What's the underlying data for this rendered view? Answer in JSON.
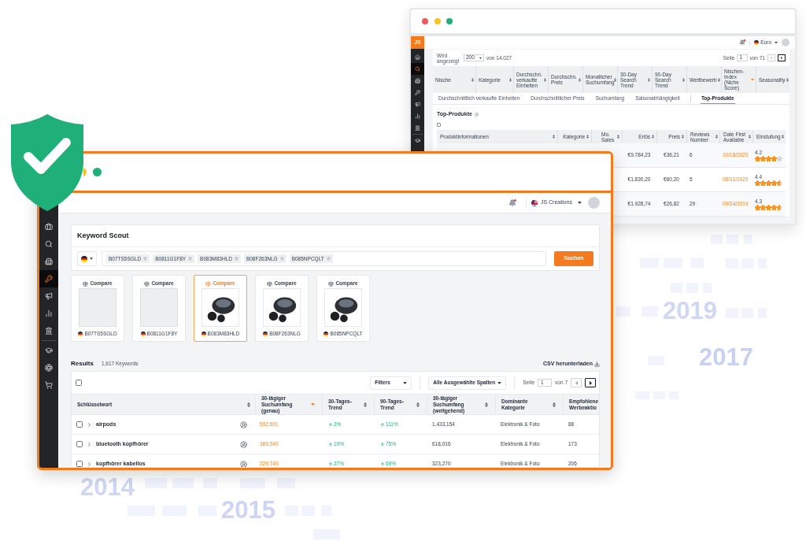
{
  "background": {
    "years": [
      "2019",
      "2017",
      "2014",
      "2015"
    ]
  },
  "back_window": {
    "logo": "JS",
    "sidebar_groups": [
      [
        {
          "selected": false
        },
        {
          "selected": true
        },
        {
          "selected": false
        },
        {
          "selected": false
        },
        {
          "selected": false
        },
        {
          "selected": false
        },
        {
          "selected": false
        }
      ],
      [
        {
          "selected": false
        }
      ]
    ],
    "currency": "Euro",
    "pager": {
      "shown_label": "Wird angezeigt",
      "page_size": "200",
      "total": "von 14.027",
      "page_label": "Seite",
      "page": "1",
      "page_count": "von 71"
    },
    "niche_columns": [
      {
        "label": "Nische",
        "sorted": false
      },
      {
        "label": "Kategorie",
        "sorted": false
      },
      {
        "label": "Durchschn. verkaufte Einheiten",
        "sorted": false
      },
      {
        "label": "Durchschn. Preis",
        "sorted": false
      },
      {
        "label": "Monatlicher Suchumfang",
        "sorted": false
      },
      {
        "label": "30-Day Search Trend",
        "sorted": false
      },
      {
        "label": "90-Day Search Trend",
        "sorted": false
      },
      {
        "label": "Wettbewerb",
        "sorted": false
      },
      {
        "label": "Nischen-Index (Niche Score)",
        "sorted": true
      },
      {
        "label": "Seasonality",
        "sorted": false
      }
    ],
    "tabs": [
      {
        "label": "Durchschnittlich verkaufte Einheiten",
        "selected": false
      },
      {
        "label": "Durchschnittlicher Preis",
        "selected": false
      },
      {
        "label": "Suchumfang",
        "selected": false
      },
      {
        "label": "Saisonabhängigkeit",
        "selected": false
      },
      {
        "label": "Top-Produkte",
        "selected": true
      }
    ],
    "section_title": "Top-Produkte",
    "select_all": {
      "checked": false
    },
    "product_columns": [
      {
        "label": "Produktinformationen",
        "sorted": false
      },
      {
        "label": "Kategorie",
        "sorted": false
      },
      {
        "label": "Mo. Sales",
        "sorted": false
      },
      {
        "label": "Erlös",
        "sorted": false
      },
      {
        "label": "Preis",
        "sorted": false
      },
      {
        "label": "Reviews Number",
        "sorted": false
      },
      {
        "label": "Date First Available",
        "sorted": false
      },
      {
        "label": "Einstufung",
        "sorted": false
      }
    ],
    "products": [
      {
        "erloes": "€9.784,23",
        "preis": "€36,21",
        "reviews_number": "6",
        "date_first_available": "10/18/2020",
        "rating": "4.2",
        "stars": 4
      },
      {
        "erloes": "€1.830,20",
        "preis": "€60,20",
        "reviews_number": "5",
        "date_first_available": "08/31/2020",
        "rating": "4.4",
        "stars": 4.5
      },
      {
        "erloes": "€1.928,74",
        "preis": "€26,82",
        "reviews_number": "29",
        "date_first_available": "09/24/2019",
        "rating": "4.3",
        "stars": 4.5
      }
    ]
  },
  "front_window": {
    "sidebar_groups": [
      [
        {
          "selected": false
        },
        {
          "selected": false
        },
        {
          "selected": false
        },
        {
          "selected": true
        },
        {
          "selected": false
        },
        {
          "selected": false
        },
        {
          "selected": false
        }
      ],
      [
        {
          "selected": false
        },
        {
          "selected": false
        },
        {
          "selected": false
        }
      ]
    ],
    "account": "JS Creations",
    "keyword_scout": {
      "title": "Keyword Scout",
      "chips": [
        "B07TS5SGLD",
        "B0811G1F8Y",
        "B083M83HLD",
        "B08F263NLG",
        "B085NPCQLT"
      ],
      "search_button": "Suchen"
    },
    "products": [
      {
        "compare": "Compare",
        "asin": "B07TS5SGLD",
        "kind": "blank",
        "selected": false
      },
      {
        "compare": "Compare",
        "asin": "B0811G1F8Y",
        "kind": "blank",
        "selected": false
      },
      {
        "compare": "Compare",
        "asin": "B083M83HLD",
        "kind": "photo",
        "selected": true
      },
      {
        "compare": "Compare",
        "asin": "B08F263NLG",
        "kind": "photo",
        "selected": false
      },
      {
        "compare": "Compare",
        "asin": "B085NPCQLT",
        "kind": "photo",
        "selected": false
      }
    ],
    "results": {
      "title": "Results",
      "count": "1,617 Keywords",
      "download": "CSV herunterladen"
    },
    "toolbar": {
      "select_all": {
        "checked": false
      },
      "filters": "Filters",
      "columns": "Alle Ausgewählte Spalten",
      "page_label": "Seite",
      "page": "1",
      "page_count": "von 7"
    },
    "columns": [
      {
        "label": "Schlüsselwort",
        "sorted": false
      },
      {
        "label": "30-tägiger Suchumfang (genau)",
        "sorted": true
      },
      {
        "label": "30-Tages-Trend",
        "sorted": false
      },
      {
        "label": "90-Tages-Trend",
        "sorted": false
      },
      {
        "label": "30-tägiger Suchumfang (weitgehend)",
        "sorted": false
      },
      {
        "label": "Dominante Kategorie",
        "sorted": false
      },
      {
        "label": "Empfohlene Werbeaktio"
      }
    ],
    "rows": [
      {
        "checked": false,
        "expanded": false,
        "keyword": "airpods",
        "exact_volume": "592,691",
        "trend_30": {
          "rising": true,
          "value": "2%"
        },
        "trend_90": {
          "rising": true,
          "value": "111%"
        },
        "broad_volume": "1,433,154",
        "category": "Elektronik & Foto",
        "column_7": "88"
      },
      {
        "checked": false,
        "expanded": false,
        "keyword": "bluetooth kopfhörer",
        "exact_volume": "389,540",
        "trend_30": {
          "rising": true,
          "value": "10%"
        },
        "trend_90": {
          "rising": true,
          "value": "75%"
        },
        "broad_volume": "618,016",
        "category": "Elektronik & Foto",
        "column_7": "173"
      },
      {
        "checked": false,
        "expanded": false,
        "keyword": "kopfhörer kabellos",
        "exact_volume": "229,749",
        "trend_30": {
          "rising": true,
          "value": "27%"
        },
        "trend_90": {
          "rising": true,
          "value": "69%"
        },
        "broad_volume": "323,270",
        "category": "Elektronik & Foto",
        "column_7": "206"
      }
    ]
  }
}
